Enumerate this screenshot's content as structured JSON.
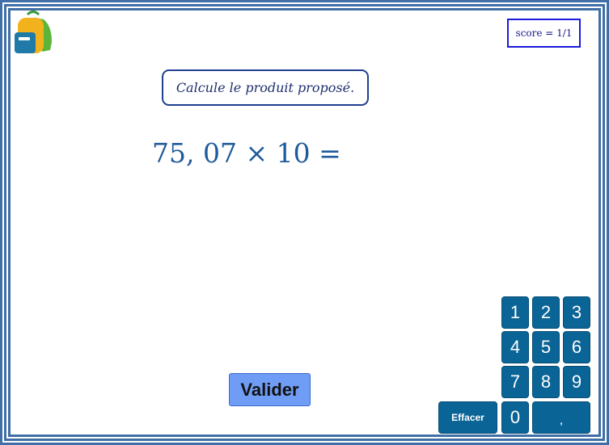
{
  "score": {
    "label": "score = 1/1"
  },
  "instruction": "Calcule le produit proposé.",
  "exercise": {
    "expression": "75, 07 × 10 ="
  },
  "validate_label": "Valider",
  "keypad": {
    "keys": [
      "1",
      "2",
      "3",
      "4",
      "5",
      "6",
      "7",
      "8",
      "9",
      "0",
      ","
    ],
    "clear_label": "Effacer"
  },
  "colors": {
    "frame": "#3f6fa6",
    "key_bg": "#0a6496",
    "validate_bg": "#6f9cf5",
    "expression_text": "#1f5a9a"
  },
  "icons": {
    "logo": "backpack-icon"
  }
}
